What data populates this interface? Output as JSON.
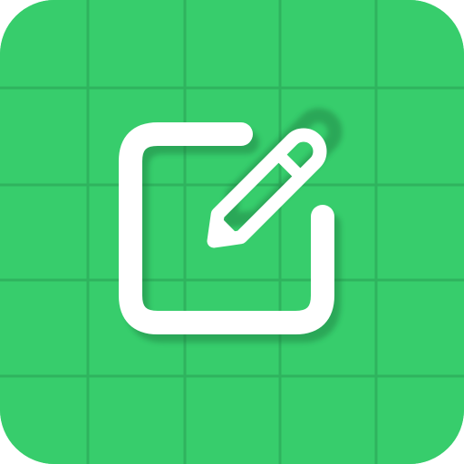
{
  "icon": {
    "name": "note-edit-app-icon",
    "background_color": "#37cd6c",
    "grid_line_color": "#2a9e54",
    "glyph_color": "#ffffff",
    "shadow_color": "#1f7a3f",
    "glyph_icon": "square-with-pencil-icon"
  }
}
